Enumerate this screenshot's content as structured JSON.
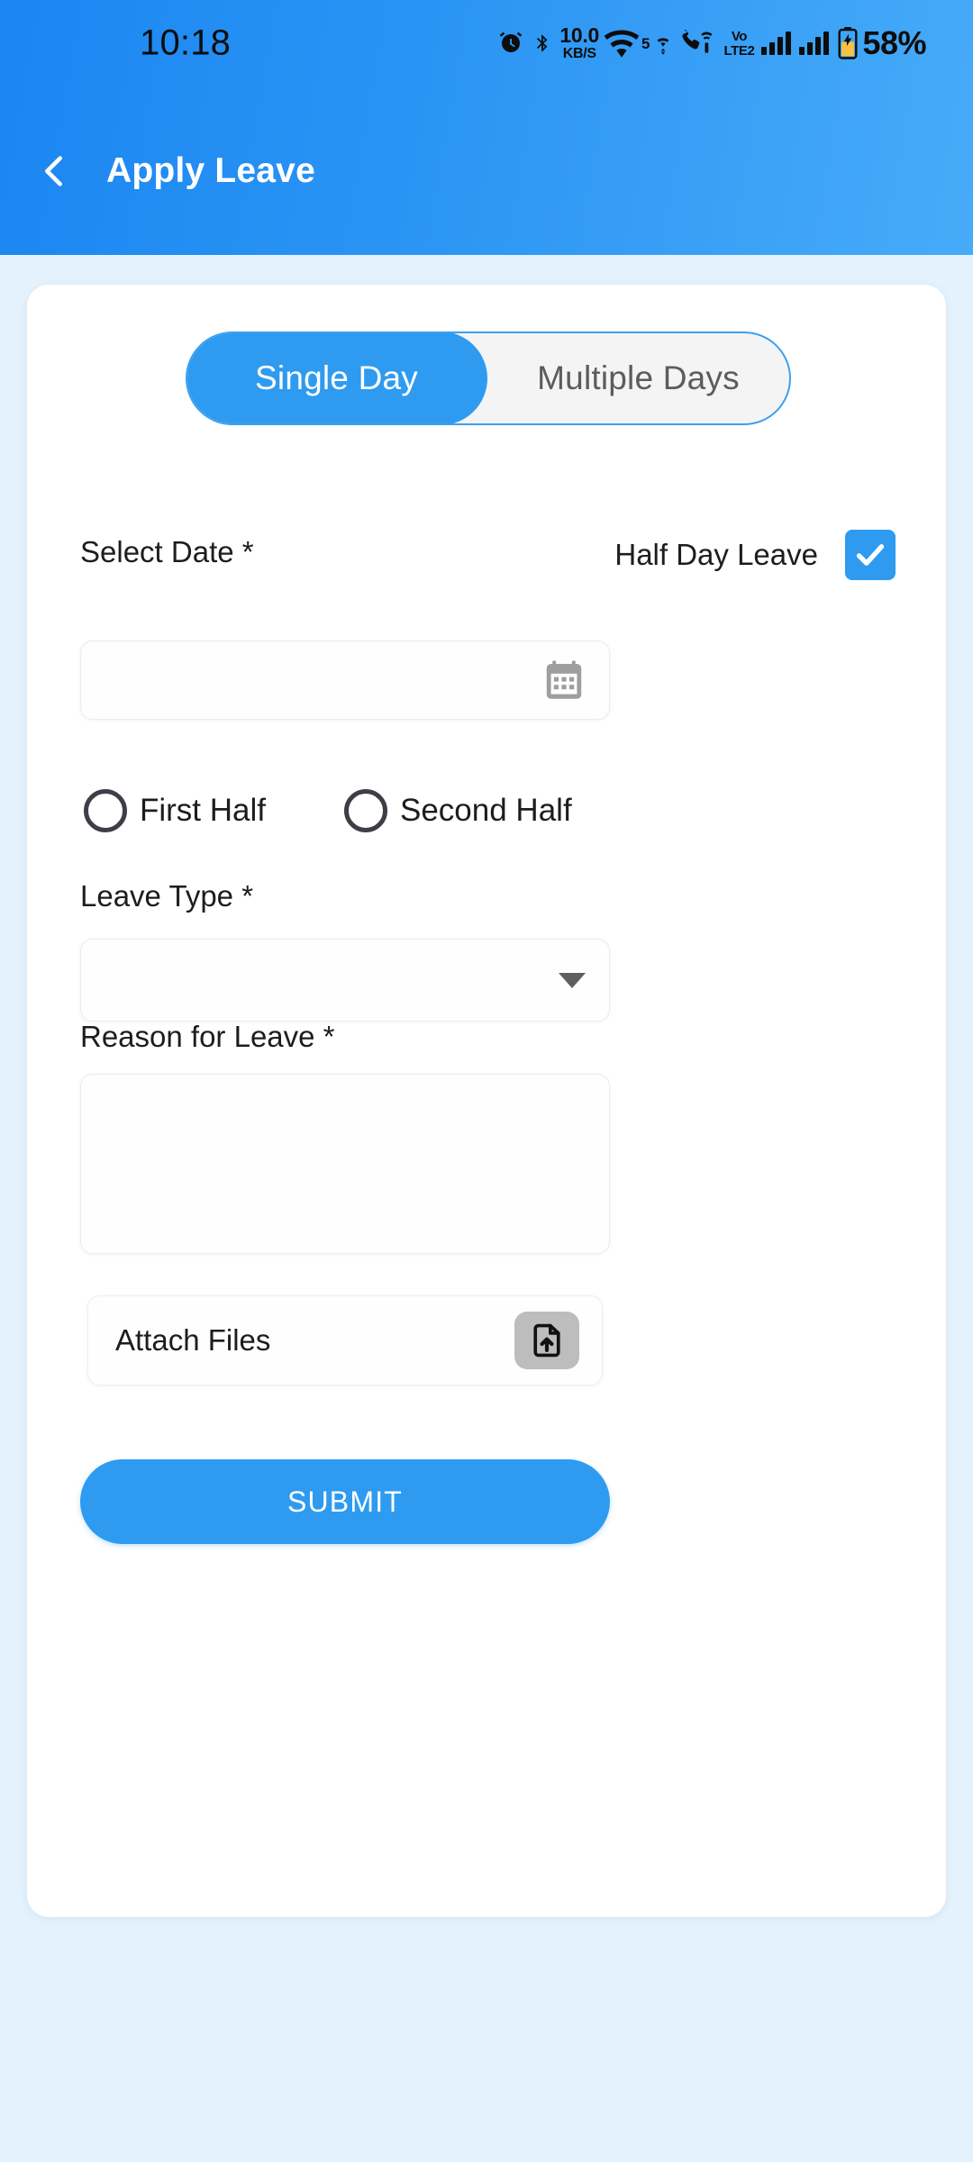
{
  "status_bar": {
    "time": "10:18",
    "network_speed_value": "10.0",
    "network_speed_unit": "KB/S",
    "wifi_band": "5",
    "volte_line1": "Vo",
    "volte_line2": "LTE2",
    "battery_percent": "58%",
    "icons": [
      "alarm-icon",
      "bluetooth-icon",
      "wifi-icon",
      "call-wifi-icon",
      "volte-icon",
      "signal-bars-icon",
      "signal-bars-icon",
      "battery-icon"
    ]
  },
  "app_bar": {
    "back_label": "back-arrow",
    "title": "Apply Leave"
  },
  "form": {
    "segmented": {
      "options": [
        {
          "label": "Single Day",
          "active": true
        },
        {
          "label": "Multiple Days",
          "active": false
        }
      ]
    },
    "select_date": {
      "label": "Select Date *",
      "value": "",
      "placeholder": "",
      "icon": "calendar-icon"
    },
    "half_day": {
      "label": "Half Day Leave",
      "checked": true
    },
    "half_day_options": [
      {
        "label": "First Half",
        "selected": false
      },
      {
        "label": "Second Half",
        "selected": false
      }
    ],
    "leave_type": {
      "label": "Leave Type *",
      "value": "",
      "placeholder": "",
      "icon": "chevron-down-icon"
    },
    "reason": {
      "label": "Reason for Leave *",
      "value": "",
      "placeholder": ""
    },
    "attach_files": {
      "label": "Attach Files",
      "icon": "file-upload-icon"
    },
    "submit": {
      "label": "SUBMIT"
    }
  },
  "colors": {
    "accent": "#2e9bf0",
    "header_start": "#1b86f2",
    "header_end": "#47abf8",
    "page_bg": "#e3f2fd",
    "card_bg": "#ffffff",
    "muted": "#9e9e9e",
    "upload_btn_bg": "#bdbdbd"
  }
}
